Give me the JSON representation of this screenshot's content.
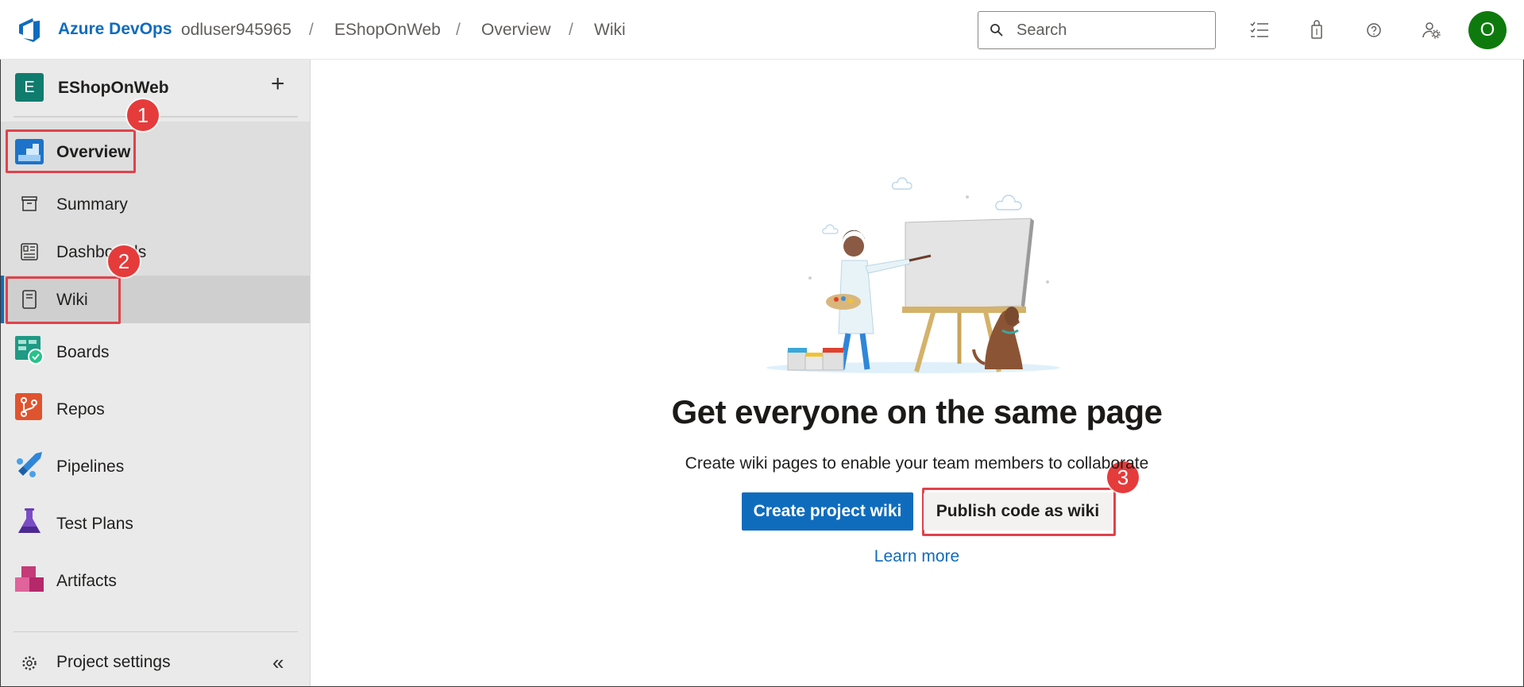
{
  "header": {
    "brand": "Azure DevOps",
    "breadcrumb": [
      "odluser945965",
      "EShopOnWeb",
      "Overview",
      "Wiki"
    ],
    "separator": "/",
    "search_placeholder": "Search",
    "avatar_initial": "O"
  },
  "sidebar": {
    "project_initial": "E",
    "project_name": "EShopOnWeb",
    "add_symbol": "+",
    "items": [
      {
        "label": "Overview",
        "icon": "overview-icon"
      },
      {
        "label": "Summary",
        "icon": "summary-icon"
      },
      {
        "label": "Dashboards",
        "icon": "dashboards-icon"
      },
      {
        "label": "Wiki",
        "icon": "wiki-icon",
        "selected": true
      },
      {
        "label": "Boards",
        "icon": "boards-icon"
      },
      {
        "label": "Repos",
        "icon": "repos-icon"
      },
      {
        "label": "Pipelines",
        "icon": "pipelines-icon"
      },
      {
        "label": "Test Plans",
        "icon": "test-plans-icon"
      },
      {
        "label": "Artifacts",
        "icon": "artifacts-icon"
      }
    ],
    "settings_label": "Project settings",
    "collapse_symbol": "«"
  },
  "main": {
    "headline": "Get everyone on the same page",
    "subtext": "Create wiki pages to enable your team members to collaborate",
    "primary_button": "Create project wiki",
    "secondary_button": "Publish code as wiki",
    "learn_more": "Learn more"
  },
  "annotations": [
    "1",
    "2",
    "3"
  ],
  "colors": {
    "accent": "#0f6cbd",
    "annotation": "#e53b3b",
    "avatar": "#0e7a0d",
    "project_tile": "#107c6e"
  }
}
